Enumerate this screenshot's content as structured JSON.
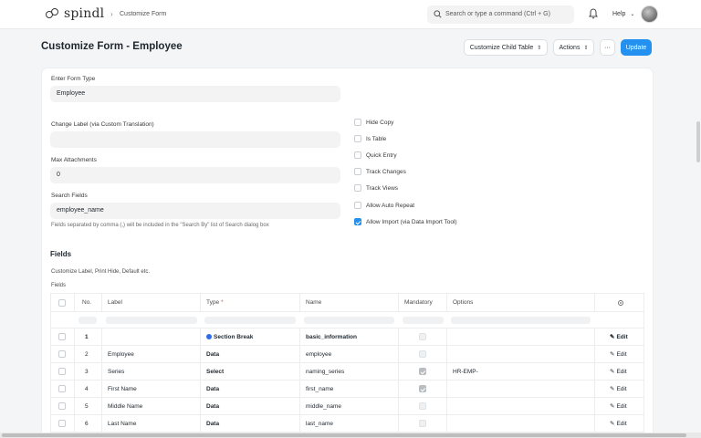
{
  "nav": {
    "brand": "spindl",
    "breadcrumb": "Customize Form",
    "search_placeholder": "Search or type a command (Ctrl + G)",
    "help_label": "Help"
  },
  "page": {
    "title": "Customize Form - Employee",
    "customize_child_label": "Customize Child Table",
    "actions_label": "Actions",
    "more_label": "···",
    "update_label": "Update"
  },
  "form": {
    "form_type_label": "Enter Form Type",
    "form_type_value": "Employee",
    "change_label_label": "Change Label (via Custom Translation)",
    "change_label_value": "",
    "max_attachments_label": "Max Attachments",
    "max_attachments_value": "0",
    "search_fields_label": "Search Fields",
    "search_fields_value": "employee_name",
    "search_fields_hint": "Fields separated by comma (,) will be included in the \"Search By\" list of Search dialog box",
    "checks": [
      {
        "label": "Hide Copy",
        "checked": false
      },
      {
        "label": "Is Table",
        "checked": false
      },
      {
        "label": "Quick Entry",
        "checked": false
      },
      {
        "label": "Track Changes",
        "checked": false
      },
      {
        "label": "Track Views",
        "checked": false
      },
      {
        "label": "Allow Auto Repeat",
        "checked": false
      },
      {
        "label": "Allow Import (via Data Import Tool)",
        "checked": true
      }
    ]
  },
  "fields_section": {
    "title": "Fields",
    "subtitle": "Customize Label, Print Hide, Default etc.",
    "table_label": "Fields",
    "columns": {
      "no": "No.",
      "label": "Label",
      "type": "Type",
      "type_required": "*",
      "name": "Name",
      "mandatory": "Mandatory",
      "options": "Options"
    },
    "edit_label": "Edit",
    "rows": [
      {
        "no": "1",
        "label": "",
        "type": "Section Break",
        "name": "basic_information",
        "mandatory": false,
        "options": ""
      },
      {
        "no": "2",
        "label": "Employee",
        "type": "Data",
        "name": "employee",
        "mandatory": false,
        "options": ""
      },
      {
        "no": "3",
        "label": "Series",
        "type": "Select",
        "name": "naming_series",
        "mandatory": true,
        "options": "HR-EMP-"
      },
      {
        "no": "4",
        "label": "First Name",
        "type": "Data",
        "name": "first_name",
        "mandatory": true,
        "options": ""
      },
      {
        "no": "5",
        "label": "Middle Name",
        "type": "Data",
        "name": "middle_name",
        "mandatory": false,
        "options": ""
      },
      {
        "no": "6",
        "label": "Last Name",
        "type": "Data",
        "name": "last_name",
        "mandatory": false,
        "options": ""
      }
    ]
  }
}
